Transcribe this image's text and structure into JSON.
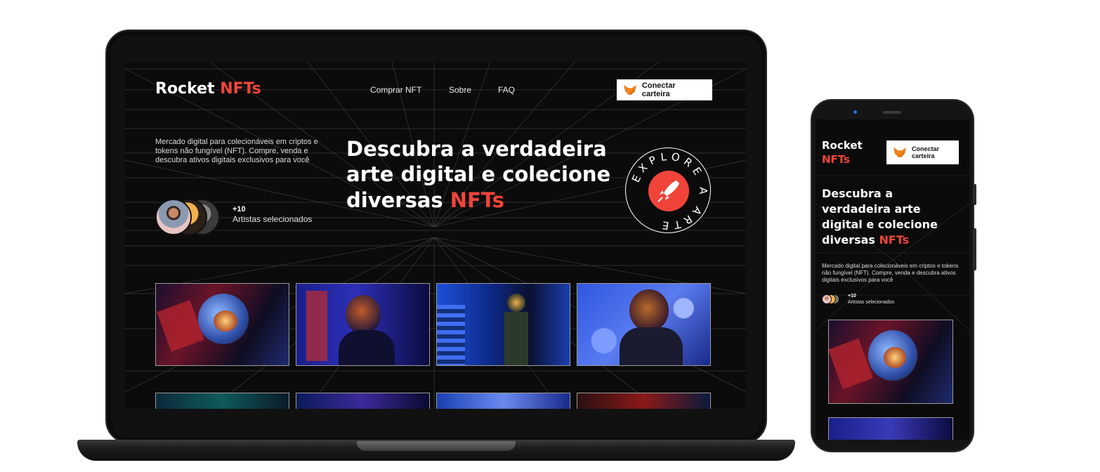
{
  "colors": {
    "accent": "#f0443a",
    "background": "#0b0b0b",
    "text": "#ffffff"
  },
  "desktop": {
    "brand": {
      "name": "Rocket",
      "accent": "NFTs"
    },
    "nav": [
      {
        "label": "Comprar NFT"
      },
      {
        "label": "Sobre"
      },
      {
        "label": "FAQ"
      }
    ],
    "wallet": {
      "label": "Conectar carteira",
      "icon": "metamask-fox-icon"
    },
    "hero": {
      "description": "Mercado digital para colecionáveis em criptos e tokens não fungível (NFT). Compre, venda e descubra ativos digitais exclusivos para você",
      "title": "Descubra a verdadeira arte digital e colecione diversas",
      "title_accent": "NFTs"
    },
    "artists": {
      "count": "+10",
      "label": "Artistas selecionados"
    },
    "badge": {
      "ring_text": "EXPLORE A ARTE",
      "icon": "rocket-icon"
    }
  },
  "mobile": {
    "brand": {
      "name": "Rocket",
      "accent": "NFTs"
    },
    "wallet": {
      "label": "Conectar carteira",
      "icon": "metamask-fox-icon"
    },
    "hero": {
      "title": "Descubra a verdadeira arte digital e colecione diversas",
      "title_accent": "NFTs",
      "description": "Mercado digital para colecionáveis em criptos e tokens não fungível (NFT). Compre, venda e descubra ativos digitais exclusivos para você"
    },
    "artists": {
      "count": "+10",
      "label": "Artistas selecionados"
    }
  }
}
